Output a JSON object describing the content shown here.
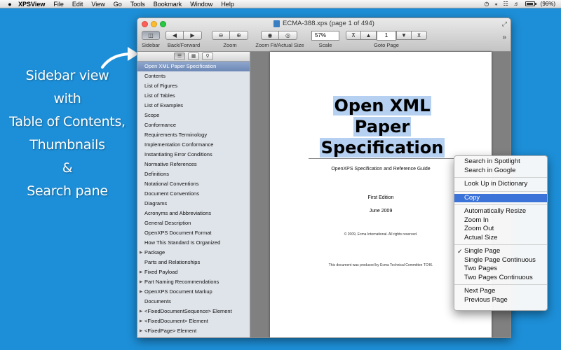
{
  "menubar": {
    "app_name": "XPSView",
    "items": [
      "File",
      "Edit",
      "View",
      "Go",
      "Tools",
      "Bookmark",
      "Window",
      "Help"
    ],
    "battery": "(96%)"
  },
  "annotation": {
    "lines": [
      "Sidebar view",
      "with",
      "Table of Contents,",
      "Thumbnails",
      "&",
      "Search pane"
    ]
  },
  "window": {
    "title": "ECMA-388.xps (page 1 of 494)"
  },
  "toolbar": {
    "sidebar_label": "Sidebar",
    "backforward_label": "Back/Forward",
    "zoom_label": "Zoom",
    "zoomfit_label": "Zoom Fit/Actual Size",
    "scale_label": "Scale",
    "scale_value": "57%",
    "goto_label": "Goto Page",
    "page_value": "1"
  },
  "sidebar": {
    "toc": [
      {
        "label": "Open XML Paper Specification",
        "expandable": false,
        "selected": true
      },
      {
        "label": "Contents",
        "expandable": false
      },
      {
        "label": "List of Figures",
        "expandable": false
      },
      {
        "label": "List of Tables",
        "expandable": false
      },
      {
        "label": "List of Examples",
        "expandable": false
      },
      {
        "label": "Scope",
        "expandable": false
      },
      {
        "label": "Conformance",
        "expandable": false
      },
      {
        "label": "Requirements Terminology",
        "expandable": false
      },
      {
        "label": "Implementation Conformance",
        "expandable": false
      },
      {
        "label": "Instantiating Error Conditions",
        "expandable": false
      },
      {
        "label": "Normative References",
        "expandable": false
      },
      {
        "label": "Definitions",
        "expandable": false
      },
      {
        "label": "Notational Conventions",
        "expandable": false
      },
      {
        "label": "Document Conventions",
        "expandable": false
      },
      {
        "label": "Diagrams",
        "expandable": false
      },
      {
        "label": "Acronyms and Abbreviations",
        "expandable": false
      },
      {
        "label": "General Description",
        "expandable": false
      },
      {
        "label": "OpenXPS Document Format",
        "expandable": false
      },
      {
        "label": "How This Standard Is Organized",
        "expandable": false
      },
      {
        "label": "Package",
        "expandable": true
      },
      {
        "label": "Parts and Relationships",
        "expandable": false
      },
      {
        "label": "Fixed Payload",
        "expandable": true
      },
      {
        "label": "Part Naming Recommendations",
        "expandable": true
      },
      {
        "label": "OpenXPS Document Markup",
        "expandable": true
      },
      {
        "label": "Documents",
        "expandable": false
      },
      {
        "label": "<FixedDocumentSequence> Element",
        "expandable": true
      },
      {
        "label": "<FixedDocument> Element",
        "expandable": true
      },
      {
        "label": "<FixedPage> Element",
        "expandable": true
      }
    ]
  },
  "document": {
    "title_lines": [
      "Open XML",
      "Paper",
      "Specification"
    ],
    "subtitle": "OpenXPS Specification and Reference Guide",
    "edition": "First Edition",
    "date": "June 2009",
    "copyright": "© 2009, Ecma International. All rights reserved.",
    "produced": "This document was produced by Ecma Technical Committee TC46."
  },
  "context_menu": {
    "groups": [
      [
        {
          "label": "Search in Spotlight"
        },
        {
          "label": "Search in Google"
        }
      ],
      [
        {
          "label": "Look Up in Dictionary"
        }
      ],
      [
        {
          "label": "Copy",
          "highlighted": true
        }
      ],
      [
        {
          "label": "Automatically Resize"
        },
        {
          "label": "Zoom In"
        },
        {
          "label": "Zoom Out"
        },
        {
          "label": "Actual Size"
        }
      ],
      [
        {
          "label": "Single Page",
          "checked": true
        },
        {
          "label": "Single Page Continuous"
        },
        {
          "label": "Two Pages"
        },
        {
          "label": "Two Pages Continuous"
        }
      ],
      [
        {
          "label": "Next Page"
        },
        {
          "label": "Previous Page"
        }
      ]
    ]
  }
}
